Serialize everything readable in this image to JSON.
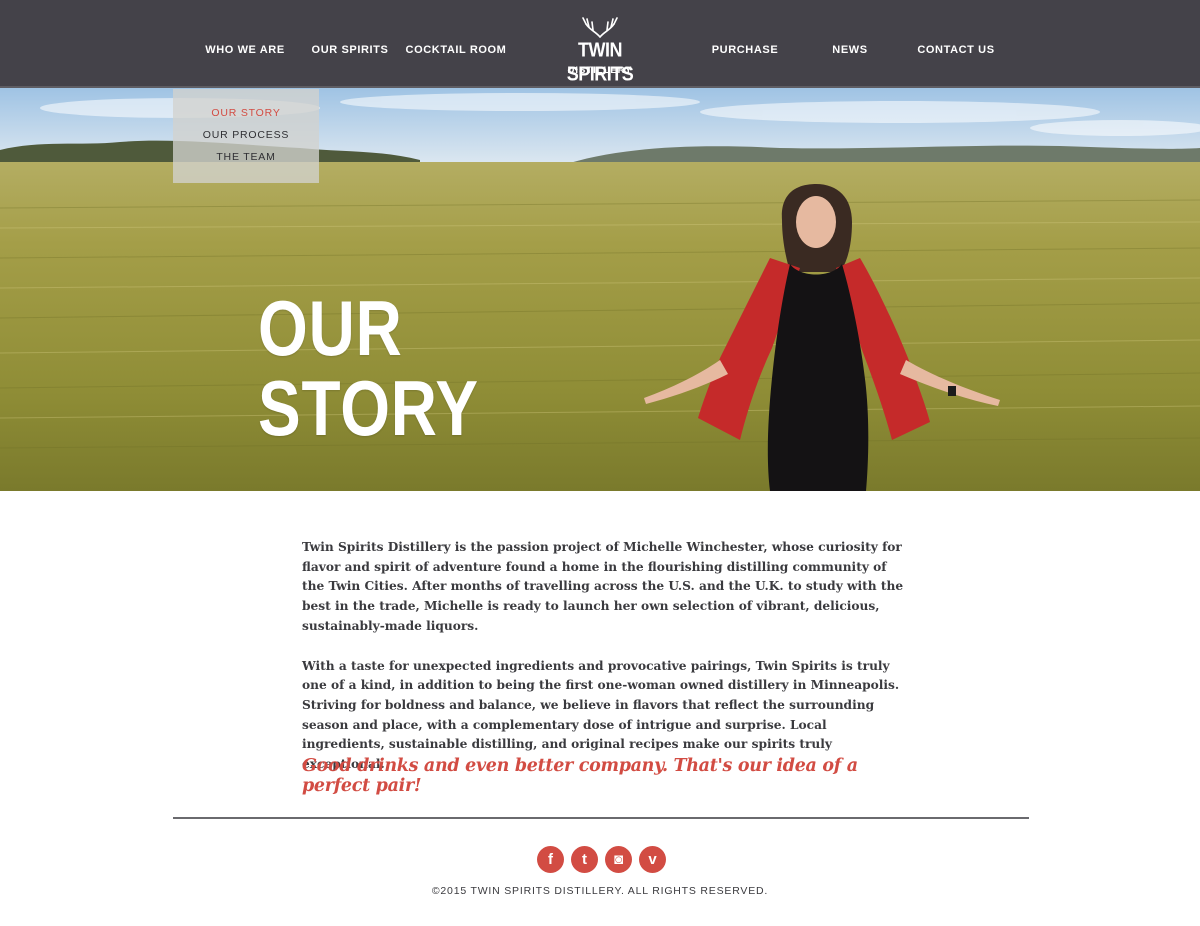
{
  "nav": {
    "left": [
      {
        "label": "WHO WE ARE"
      },
      {
        "label": "OUR SPIRITS"
      },
      {
        "label": "COCKTAIL ROOM"
      }
    ],
    "right": [
      {
        "label": "PURCHASE"
      },
      {
        "label": "NEWS"
      },
      {
        "label": "CONTACT US"
      }
    ],
    "logo": {
      "brand": "TWIN SPIRITS",
      "sub": "DISTILLERY",
      "icon": "antler-icon"
    }
  },
  "subnav": {
    "items": [
      {
        "label": "OUR STORY",
        "active": true
      },
      {
        "label": "OUR PROCESS",
        "active": false
      },
      {
        "label": "THE TEAM",
        "active": false
      }
    ]
  },
  "hero": {
    "title_line1": "OUR",
    "title_line2": "STORY"
  },
  "content": {
    "paragraph1": "Twin Spirits Distillery is the passion project of Michelle Winchester, whose curiosity for flavor and spirit of adventure found a home in the flourishing distilling community of the Twin Cities. After months of travelling across the U.S. and the U.K. to study with the best in the trade, Michelle is ready to launch her own selection of vibrant, delicious, sustainably-made liquors.",
    "paragraph2": "With a taste for unexpected ingredients and provocative pairings, Twin Spirits is truly one of a kind, in addition to being the first one-woman owned distillery in Minneapolis. Striving for boldness and balance, we believe in flavors that reflect the surrounding season and place, with a complementary dose of intrigue and surprise. Local ingredients, sustainable distilling, and original recipes make our spirits truly exceptional.",
    "tagline": "Good drinks and even better company. That's our idea of a perfect pair!"
  },
  "footer": {
    "social": [
      {
        "name": "facebook-icon",
        "glyph": "f"
      },
      {
        "name": "twitter-icon",
        "glyph": "t"
      },
      {
        "name": "instagram-icon",
        "glyph": "◙"
      },
      {
        "name": "vine-icon",
        "glyph": "v"
      }
    ],
    "copyright": "©2015 TWIN SPIRITS DISTILLERY. ALL RIGHTS RESERVED."
  },
  "colors": {
    "nav_bg": "#444249",
    "accent": "#d24c43",
    "text": "#3a3a3e"
  }
}
